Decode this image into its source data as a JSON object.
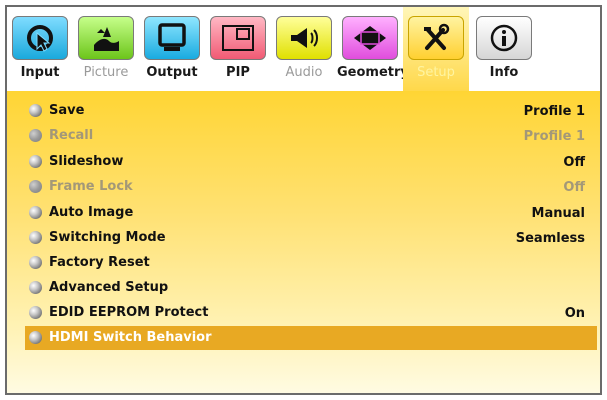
{
  "tabs": [
    {
      "label": "Input",
      "icon": "input-cursor-icon",
      "color": "#2ab7e6",
      "state": "normal"
    },
    {
      "label": "Picture",
      "icon": "picture-landscape-icon",
      "color": "#7ed321",
      "state": "dim"
    },
    {
      "label": "Output",
      "icon": "monitor-icon",
      "color": "#22b8e8",
      "state": "normal"
    },
    {
      "label": "PIP",
      "icon": "pip-icon",
      "color": "#f46e84",
      "state": "normal"
    },
    {
      "label": "Audio",
      "icon": "speaker-icon",
      "color": "#e8e800",
      "state": "dim"
    },
    {
      "label": "Geometry",
      "icon": "geometry-diamond-icon",
      "color": "#e35ae0",
      "state": "normal"
    },
    {
      "label": "Setup",
      "icon": "tools-icon",
      "color": "#ffd84a",
      "state": "selected"
    },
    {
      "label": "Info",
      "icon": "info-icon",
      "color": "#e0e0e0",
      "state": "normal"
    }
  ],
  "menu": [
    {
      "name": "Save",
      "value": "Profile 1",
      "state": "enabled"
    },
    {
      "name": "Recall",
      "value": "Profile 1",
      "state": "disabled"
    },
    {
      "name": "Slideshow",
      "value": "Off",
      "state": "enabled"
    },
    {
      "name": "Frame Lock",
      "value": "Off",
      "state": "disabled"
    },
    {
      "name": "Auto Image",
      "value": "Manual",
      "state": "enabled"
    },
    {
      "name": "Switching Mode",
      "value": "Seamless",
      "state": "enabled"
    },
    {
      "name": "Factory Reset",
      "value": "",
      "state": "enabled"
    },
    {
      "name": "Advanced Setup",
      "value": "",
      "state": "enabled"
    },
    {
      "name": "EDID EEPROM Protect",
      "value": "On",
      "state": "enabled"
    },
    {
      "name": "HDMI Switch Behavior",
      "value": "",
      "state": "highlighted"
    }
  ],
  "colors": {
    "highlight": "#e8a923",
    "content_top": "#ffd534",
    "content_bottom": "#fffbe2"
  }
}
